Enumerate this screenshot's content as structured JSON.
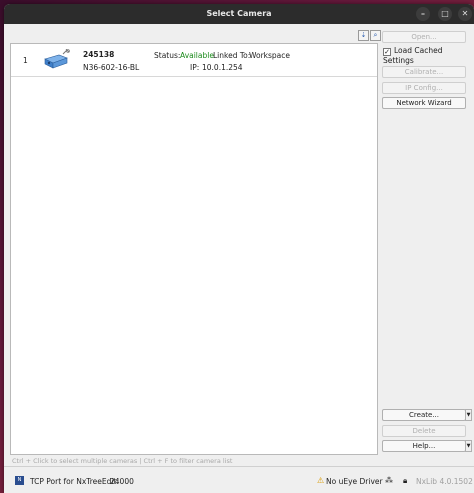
{
  "window": {
    "title": "Select Camera",
    "minimize_glyph": "–",
    "maximize_glyph": "□",
    "close_glyph": "✕"
  },
  "list_tools": {
    "sort_icon": "sort-down-icon",
    "filter_icon": "search-icon"
  },
  "cameras": [
    {
      "index": "1",
      "serial": "245138",
      "model": "N36-602-16-BL",
      "status_label": "Status:",
      "status_value": "Available",
      "linked_label": "Linked To:",
      "linked_value": "Workspace",
      "ip_label": "IP:",
      "ip_value": "10.0.1.254",
      "icon": "camera-icon"
    }
  ],
  "actions": {
    "open": "Open...",
    "load_cached": "Load Cached Settings",
    "load_cached_checked": true,
    "calibrate": "Calibrate...",
    "ip_config": "IP Config...",
    "network_wizard": "Network Wizard",
    "create": "Create...",
    "delete": "Delete",
    "help": "Help..."
  },
  "hint": "Ctrl + Click to select multiple cameras | Ctrl + F to filter camera list",
  "statusbar": {
    "tcp_label": "TCP Port for NxTreeEdit:",
    "tcp_port": "24000",
    "driver_status": "No uEye Driver",
    "version": "NxLib 4.0.1502"
  },
  "colors": {
    "available": "#1a8a1a",
    "warning": "#d99a00",
    "titlebar": "#2c2c2c"
  }
}
